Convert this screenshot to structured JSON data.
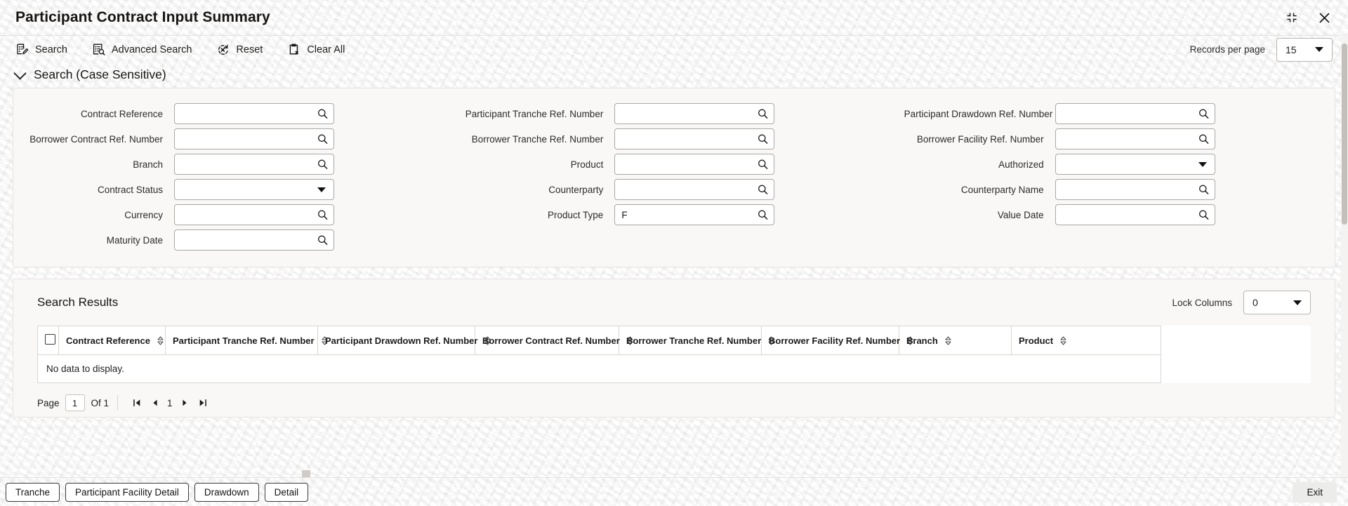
{
  "window": {
    "title": "Participant Contract Input Summary",
    "restore_icon": "restore-down-icon",
    "close_icon": "close-icon"
  },
  "toolbar": {
    "items": [
      {
        "label": "Search",
        "icon": "search-form-icon"
      },
      {
        "label": "Advanced Search",
        "icon": "advanced-search-icon"
      },
      {
        "label": "Reset",
        "icon": "reset-icon"
      },
      {
        "label": "Clear All",
        "icon": "clear-all-icon"
      }
    ],
    "records_per_page_label": "Records per page",
    "records_per_page_value": "15"
  },
  "search_section": {
    "title": "Search (Case Sensitive)",
    "collapsed": false,
    "fields": [
      {
        "label": "Contract Reference",
        "value": "",
        "control": "lov",
        "col": 1,
        "row": 1
      },
      {
        "label": "Borrower Contract Ref. Number",
        "value": "",
        "control": "lov",
        "col": 1,
        "row": 2
      },
      {
        "label": "Branch",
        "value": "",
        "control": "lov",
        "col": 1,
        "row": 3
      },
      {
        "label": "Contract Status",
        "value": "",
        "control": "dropdown",
        "col": 1,
        "row": 4
      },
      {
        "label": "Currency",
        "value": "",
        "control": "lov",
        "col": 1,
        "row": 5
      },
      {
        "label": "Maturity Date",
        "value": "",
        "control": "lov",
        "col": 1,
        "row": 6
      },
      {
        "label": "Participant Tranche Ref. Number",
        "value": "",
        "control": "lov",
        "col": 2,
        "row": 1
      },
      {
        "label": "Borrower Tranche Ref. Number",
        "value": "",
        "control": "lov",
        "col": 2,
        "row": 2
      },
      {
        "label": "Product",
        "value": "",
        "control": "lov",
        "col": 2,
        "row": 3
      },
      {
        "label": "Counterparty",
        "value": "",
        "control": "lov",
        "col": 2,
        "row": 4
      },
      {
        "label": "Product Type",
        "value": "F",
        "control": "lov",
        "col": 2,
        "row": 5
      },
      {
        "label": "Participant Drawdown Ref. Number",
        "value": "",
        "control": "lov",
        "col": 3,
        "row": 1
      },
      {
        "label": "Borrower Facility Ref. Number",
        "value": "",
        "control": "lov",
        "col": 3,
        "row": 2
      },
      {
        "label": "Authorized",
        "value": "",
        "control": "dropdown",
        "col": 3,
        "row": 3
      },
      {
        "label": "Counterparty Name",
        "value": "",
        "control": "lov",
        "col": 3,
        "row": 4
      },
      {
        "label": "Value Date",
        "value": "",
        "control": "lov",
        "col": 3,
        "row": 5
      }
    ]
  },
  "results": {
    "title": "Search Results",
    "lock_columns_label": "Lock Columns",
    "lock_columns_value": "0",
    "select_all_checked": false,
    "columns": [
      "Contract Reference",
      "Participant Tranche Ref. Number",
      "Participant Drawdown Ref. Number",
      "Borrower Contract Ref. Number",
      "Borrower Tranche Ref. Number",
      "Borrower Facility Ref. Number",
      "Branch",
      "Product"
    ],
    "rows": [],
    "empty_message": "No data to display."
  },
  "pagination": {
    "page_label": "Page",
    "page_value": "1",
    "of_label": "Of 1",
    "current_page": "1",
    "first_icon": "first-page-icon",
    "prev_icon": "previous-page-icon",
    "next_icon": "next-page-icon",
    "last_icon": "last-page-icon"
  },
  "footer": {
    "buttons": [
      {
        "label": "Tranche"
      },
      {
        "label": "Participant Facility Detail"
      },
      {
        "label": "Drawdown"
      },
      {
        "label": "Detail"
      }
    ],
    "exit_label": "Exit"
  },
  "colors": {
    "panel_bg": "#f9f8f7",
    "border": "#d9d6d2",
    "text": "#1c1c1c",
    "page_bg": "#ffffff"
  }
}
